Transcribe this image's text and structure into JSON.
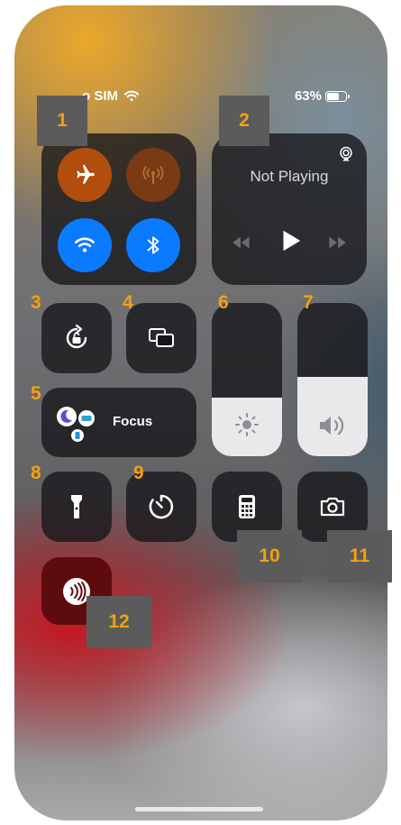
{
  "status_bar": {
    "carrier": "o SIM",
    "battery": "63%"
  },
  "media": {
    "title": "Not Playing"
  },
  "focus": {
    "label": "Focus"
  },
  "labels": {
    "l1": "1",
    "l2": "2",
    "l3": "3",
    "l4": "4",
    "l5": "5",
    "l6": "6",
    "l7": "7",
    "l8": "8",
    "l9": "9",
    "l10": "10",
    "l11": "11",
    "l12": "12"
  },
  "sliders": {
    "brightness_level": 0.38,
    "volume_level": 0.52
  },
  "colors": {
    "airplane_active": "#b14d0d",
    "cellular_active": "#7a3a14",
    "wifi_active": "#0a7aff",
    "bluetooth_active": "#0a7aff",
    "label_color": "#f4a011",
    "nfc_tile": "#5e0b0e"
  },
  "icons": {
    "airplane": "airplane-icon",
    "cellular": "cellular-antenna-icon",
    "wifi": "wifi-icon",
    "bluetooth": "bluetooth-icon",
    "airplay": "airplay-icon",
    "rewind": "rewind-icon",
    "play": "play-icon",
    "forward": "fast-forward-icon",
    "rotation": "rotation-lock-icon",
    "mirror": "screen-mirroring-icon",
    "brightness": "brightness-icon",
    "volume": "volume-icon",
    "focus": "focus-moon-icon",
    "flashlight": "flashlight-icon",
    "timer": "timer-icon",
    "calculator": "calculator-icon",
    "camera": "camera-icon",
    "nfc": "nfc-icon"
  }
}
